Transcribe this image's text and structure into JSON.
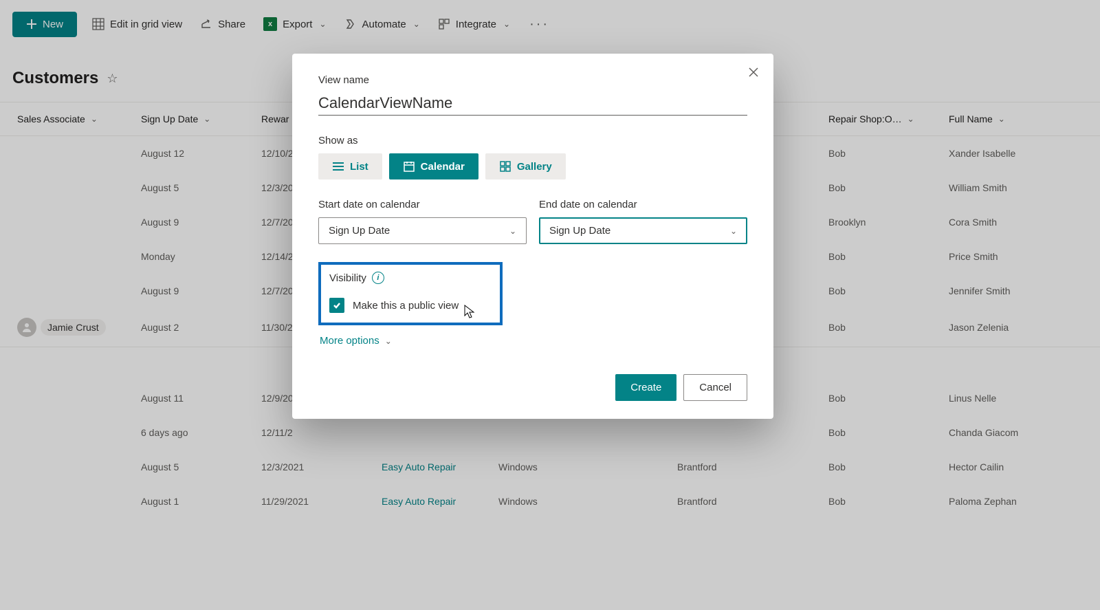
{
  "toolbar": {
    "new_label": "New",
    "edit_grid_label": "Edit in grid view",
    "share_label": "Share",
    "export_label": "Export",
    "automate_label": "Automate",
    "integrate_label": "Integrate"
  },
  "page": {
    "title": "Customers"
  },
  "columns": {
    "sales_associate": "Sales Associate",
    "sign_up_date": "Sign Up Date",
    "reward": "Rewar",
    "repair_shop_o": "Repair Shop:O…",
    "full_name": "Full Name"
  },
  "rows": [
    {
      "associate": "",
      "date": "August 12",
      "reward": "12/10/2",
      "shop": "",
      "os": "",
      "city": "",
      "person": "Bob",
      "fullname": "Xander Isabelle"
    },
    {
      "associate": "",
      "date": "August 5",
      "reward": "12/3/20",
      "shop": "",
      "os": "",
      "city": "",
      "person": "Bob",
      "fullname": "William Smith"
    },
    {
      "associate": "",
      "date": "August 9",
      "reward": "12/7/20",
      "shop": "",
      "os": "",
      "city": "",
      "person": "Brooklyn",
      "fullname": "Cora Smith"
    },
    {
      "associate": "",
      "date": "Monday",
      "reward": "12/14/2",
      "shop": "",
      "os": "",
      "city": "",
      "person": "Bob",
      "fullname": "Price Smith"
    },
    {
      "associate": "",
      "date": "August 9",
      "reward": "12/7/20",
      "shop": "",
      "os": "",
      "city": "",
      "person": "Bob",
      "fullname": "Jennifer Smith"
    },
    {
      "associate": "Jamie Crust",
      "date": "August 2",
      "reward": "11/30/2",
      "shop": "",
      "os": "",
      "city": "",
      "person": "Bob",
      "fullname": "Jason Zelenia"
    },
    {
      "associate": "",
      "date": "August 11",
      "reward": "12/9/20",
      "shop": "",
      "os": "",
      "city": "",
      "person": "Bob",
      "fullname": "Linus Nelle"
    },
    {
      "associate": "",
      "date": "6 days ago",
      "reward": "12/11/2",
      "shop": "",
      "os": "",
      "city": "",
      "person": "Bob",
      "fullname": "Chanda Giacom"
    },
    {
      "associate": "",
      "date": "August 5",
      "reward": "12/3/2021",
      "shop": "Easy Auto Repair",
      "os": "Windows",
      "city": "Brantford",
      "person": "Bob",
      "fullname": "Hector Cailin"
    },
    {
      "associate": "",
      "date": "August 1",
      "reward": "11/29/2021",
      "shop": "Easy Auto Repair",
      "os": "Windows",
      "city": "Brantford",
      "person": "Bob",
      "fullname": "Paloma Zephan"
    }
  ],
  "modal": {
    "view_name_label": "View name",
    "view_name_value": "CalendarViewName",
    "show_as_label": "Show as",
    "show_as_options": {
      "list": "List",
      "calendar": "Calendar",
      "gallery": "Gallery"
    },
    "start_date_label": "Start date on calendar",
    "start_date_value": "Sign Up Date",
    "end_date_label": "End date on calendar",
    "end_date_value": "Sign Up Date",
    "visibility_label": "Visibility",
    "public_view_label": "Make this a public view",
    "more_options_label": "More options",
    "create_label": "Create",
    "cancel_label": "Cancel"
  }
}
